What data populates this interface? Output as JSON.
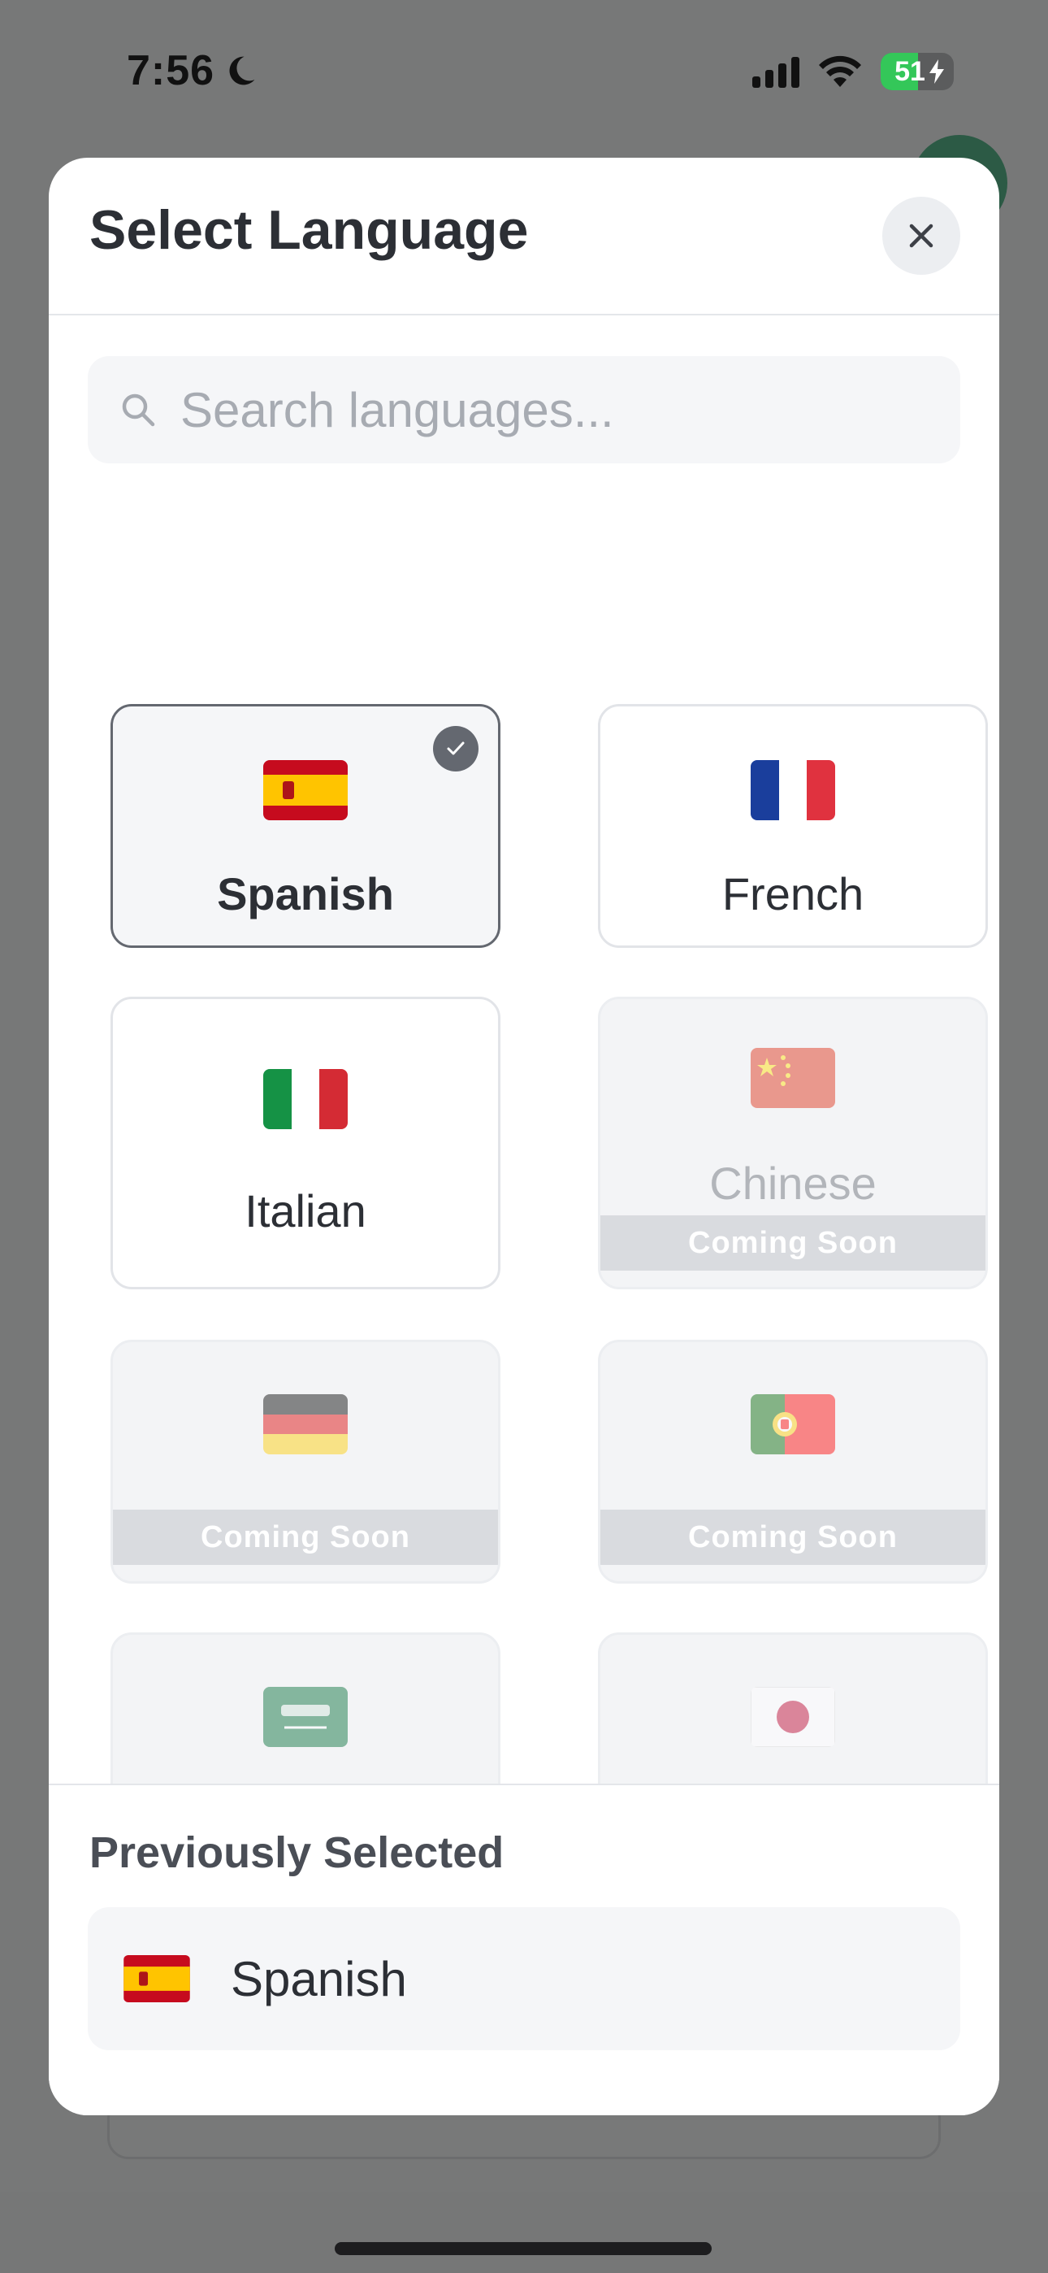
{
  "status_bar": {
    "time": "7:56",
    "battery": "51",
    "battery_level": 0.51
  },
  "modal": {
    "title": "Select Language",
    "close_icon": "close-icon"
  },
  "search": {
    "placeholder": "Search languages...",
    "value": ""
  },
  "languages": [
    {
      "name": "Spanish",
      "flag": "spain-flag-icon",
      "selected": true,
      "available": true
    },
    {
      "name": "French",
      "flag": "france-flag-icon",
      "selected": false,
      "available": true
    },
    {
      "name": "Italian",
      "flag": "italy-flag-icon",
      "selected": false,
      "available": true
    },
    {
      "name": "Chinese",
      "flag": "china-flag-icon",
      "selected": false,
      "available": false
    },
    {
      "name": "",
      "flag": "germany-flag-icon",
      "selected": false,
      "available": false
    },
    {
      "name": "",
      "flag": "portugal-flag-icon",
      "selected": false,
      "available": false
    },
    {
      "name": "",
      "flag": "saudi-arabia-flag-icon",
      "selected": false,
      "available": false
    },
    {
      "name": "",
      "flag": "japan-flag-icon",
      "selected": false,
      "available": false
    }
  ],
  "coming_soon_label": "Coming Soon",
  "previously_selected": {
    "title": "Previously Selected",
    "item": {
      "name": "Spanish",
      "flag": "spain-flag-icon"
    }
  },
  "colors": {
    "selected_border": "#646870",
    "coming_soon_band": "#d9dbdf",
    "battery_green": "#34c759",
    "overlay": "#777878"
  }
}
